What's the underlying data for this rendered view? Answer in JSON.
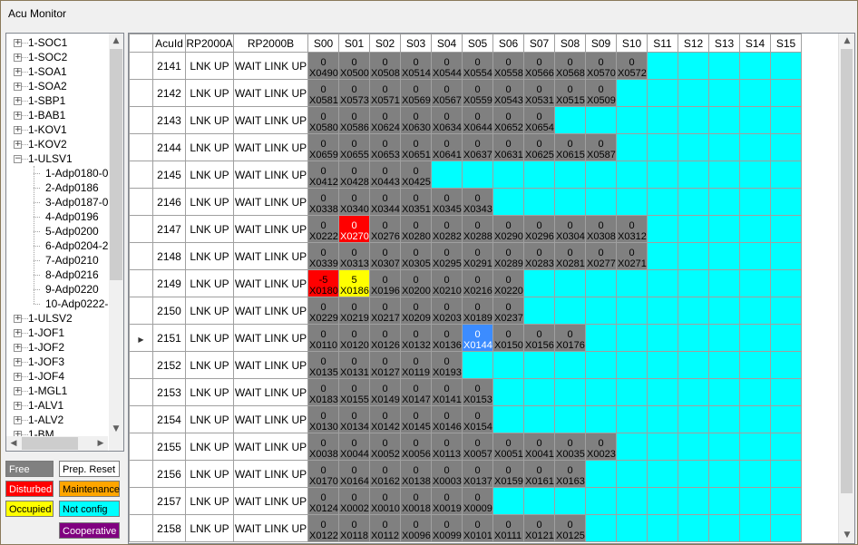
{
  "window": {
    "title": "Acu Monitor"
  },
  "tree": {
    "nodes": [
      {
        "label": "1-SOC1",
        "level": 0,
        "exp": "+"
      },
      {
        "label": "1-SOC2",
        "level": 0,
        "exp": "+"
      },
      {
        "label": "1-SOA1",
        "level": 0,
        "exp": "+"
      },
      {
        "label": "1-SOA2",
        "level": 0,
        "exp": "+"
      },
      {
        "label": "1-SBP1",
        "level": 0,
        "exp": "+"
      },
      {
        "label": "1-BAB1",
        "level": 0,
        "exp": "+"
      },
      {
        "label": "1-KOV1",
        "level": 0,
        "exp": "+"
      },
      {
        "label": "1-KOV2",
        "level": 0,
        "exp": "+"
      },
      {
        "label": "1-ULSV1",
        "level": 0,
        "exp": "-"
      },
      {
        "label": "1-Adp0180-0",
        "level": 1,
        "exp": ""
      },
      {
        "label": "2-Adp0186",
        "level": 1,
        "exp": ""
      },
      {
        "label": "3-Adp0187-0",
        "level": 1,
        "exp": ""
      },
      {
        "label": "4-Adp0196",
        "level": 1,
        "exp": ""
      },
      {
        "label": "5-Adp0200",
        "level": 1,
        "exp": ""
      },
      {
        "label": "6-Adp0204-2",
        "level": 1,
        "exp": ""
      },
      {
        "label": "7-Adp0210",
        "level": 1,
        "exp": ""
      },
      {
        "label": "8-Adp0216",
        "level": 1,
        "exp": ""
      },
      {
        "label": "9-Adp0220",
        "level": 1,
        "exp": ""
      },
      {
        "label": "10-Adp0222-2",
        "level": 1,
        "exp": ""
      },
      {
        "label": "1-ULSV2",
        "level": 0,
        "exp": "+"
      },
      {
        "label": "1-JOF1",
        "level": 0,
        "exp": "+"
      },
      {
        "label": "1-JOF2",
        "level": 0,
        "exp": "+"
      },
      {
        "label": "1-JOF3",
        "level": 0,
        "exp": "+"
      },
      {
        "label": "1-JOF4",
        "level": 0,
        "exp": "+"
      },
      {
        "label": "1-MGL1",
        "level": 0,
        "exp": "+"
      },
      {
        "label": "1-ALV1",
        "level": 0,
        "exp": "+"
      },
      {
        "label": "1-ALV2",
        "level": 0,
        "exp": "+"
      },
      {
        "label": "1-BM",
        "level": 0,
        "exp": "+"
      }
    ]
  },
  "legend": {
    "free": "Free",
    "prep_reset": "Prep. Reset",
    "disturbed": "Disturbed",
    "maintenance": "Maintenance",
    "occupied": "Occupied",
    "not_config": "Not config",
    "cooperative": "Cooperative"
  },
  "colors": {
    "free": "#808080",
    "disturbed": "#ff0000",
    "maintenance": "#ffa500",
    "occupied": "#ffff00",
    "not_config": "#00ffff",
    "cooperative": "#800080",
    "selected": "#3c8cff"
  },
  "grid": {
    "headers": [
      "AcuId",
      "RP2000A",
      "RP2000B",
      "S00",
      "S01",
      "S02",
      "S03",
      "S04",
      "S05",
      "S06",
      "S07",
      "S08",
      "S09",
      "S10",
      "S11",
      "S12",
      "S13",
      "S14",
      "S15"
    ],
    "current_row": 10,
    "rows": [
      {
        "acuid": "2141",
        "a": "LNK UP",
        "b": "WAIT LINK UP",
        "slots": [
          [
            "0",
            "X0490",
            "f"
          ],
          [
            "0",
            "X0500",
            "f"
          ],
          [
            "0",
            "X0508",
            "f"
          ],
          [
            "0",
            "X0514",
            "f"
          ],
          [
            "0",
            "X0544",
            "f"
          ],
          [
            "0",
            "X0554",
            "f"
          ],
          [
            "0",
            "X0558",
            "f"
          ],
          [
            "0",
            "X0566",
            "f"
          ],
          [
            "0",
            "X0568",
            "f"
          ],
          [
            "0",
            "X0570",
            "f"
          ],
          [
            "0",
            "X0572",
            "f"
          ]
        ]
      },
      {
        "acuid": "2142",
        "a": "LNK UP",
        "b": "WAIT LINK UP",
        "slots": [
          [
            "0",
            "X0581",
            "f"
          ],
          [
            "0",
            "X0573",
            "f"
          ],
          [
            "0",
            "X0571",
            "f"
          ],
          [
            "0",
            "X0569",
            "f"
          ],
          [
            "0",
            "X0567",
            "f"
          ],
          [
            "0",
            "X0559",
            "f"
          ],
          [
            "0",
            "X0543",
            "f"
          ],
          [
            "0",
            "X0531",
            "f"
          ],
          [
            "0",
            "X0515",
            "f"
          ],
          [
            "0",
            "X0509",
            "f"
          ]
        ]
      },
      {
        "acuid": "2143",
        "a": "LNK UP",
        "b": "WAIT LINK UP",
        "slots": [
          [
            "0",
            "X0580",
            "f"
          ],
          [
            "0",
            "X0586",
            "f"
          ],
          [
            "0",
            "X0624",
            "f"
          ],
          [
            "0",
            "X0630",
            "f"
          ],
          [
            "0",
            "X0634",
            "f"
          ],
          [
            "0",
            "X0644",
            "f"
          ],
          [
            "0",
            "X0652",
            "f"
          ],
          [
            "0",
            "X0654",
            "f"
          ]
        ]
      },
      {
        "acuid": "2144",
        "a": "LNK UP",
        "b": "WAIT LINK UP",
        "slots": [
          [
            "0",
            "X0659",
            "f"
          ],
          [
            "0",
            "X0655",
            "f"
          ],
          [
            "0",
            "X0653",
            "f"
          ],
          [
            "0",
            "X0651",
            "f"
          ],
          [
            "0",
            "X0641",
            "f"
          ],
          [
            "0",
            "X0637",
            "f"
          ],
          [
            "0",
            "X0631",
            "f"
          ],
          [
            "0",
            "X0625",
            "f"
          ],
          [
            "0",
            "X0615",
            "f"
          ],
          [
            "0",
            "X0587",
            "f"
          ]
        ]
      },
      {
        "acuid": "2145",
        "a": "LNK UP",
        "b": "WAIT LINK UP",
        "slots": [
          [
            "0",
            "X0412",
            "f"
          ],
          [
            "0",
            "X0428",
            "f"
          ],
          [
            "0",
            "X0443",
            "f"
          ],
          [
            "0",
            "X0425",
            "f"
          ]
        ]
      },
      {
        "acuid": "2146",
        "a": "LNK UP",
        "b": "WAIT LINK UP",
        "slots": [
          [
            "0",
            "X0338",
            "f"
          ],
          [
            "0",
            "X0340",
            "f"
          ],
          [
            "0",
            "X0344",
            "f"
          ],
          [
            "0",
            "X0351",
            "f"
          ],
          [
            "0",
            "X0345",
            "f"
          ],
          [
            "0",
            "X0343",
            "f"
          ]
        ]
      },
      {
        "acuid": "2147",
        "a": "LNK UP",
        "b": "WAIT LINK UP",
        "slots": [
          [
            "0",
            "X0222",
            "f"
          ],
          [
            "0",
            "X0270",
            "d"
          ],
          [
            "0",
            "X0276",
            "f"
          ],
          [
            "0",
            "X0280",
            "f"
          ],
          [
            "0",
            "X0282",
            "f"
          ],
          [
            "0",
            "X0288",
            "f"
          ],
          [
            "0",
            "X0290",
            "f"
          ],
          [
            "0",
            "X0296",
            "f"
          ],
          [
            "0",
            "X0304",
            "f"
          ],
          [
            "0",
            "X0308",
            "f"
          ],
          [
            "0",
            "X0312",
            "f"
          ]
        ]
      },
      {
        "acuid": "2148",
        "a": "LNK UP",
        "b": "WAIT LINK UP",
        "slots": [
          [
            "0",
            "X0339",
            "f"
          ],
          [
            "0",
            "X0313",
            "f"
          ],
          [
            "0",
            "X0307",
            "f"
          ],
          [
            "0",
            "X0305",
            "f"
          ],
          [
            "0",
            "X0295",
            "f"
          ],
          [
            "0",
            "X0291",
            "f"
          ],
          [
            "0",
            "X0289",
            "f"
          ],
          [
            "0",
            "X0283",
            "f"
          ],
          [
            "0",
            "X0281",
            "f"
          ],
          [
            "0",
            "X0277",
            "f"
          ],
          [
            "0",
            "X0271",
            "f"
          ]
        ]
      },
      {
        "acuid": "2149",
        "a": "LNK UP",
        "b": "WAIT LINK UP",
        "slots": [
          [
            "-5",
            "X0180",
            "d"
          ],
          [
            "5",
            "X0186",
            "o"
          ],
          [
            "0",
            "X0196",
            "f"
          ],
          [
            "0",
            "X0200",
            "f"
          ],
          [
            "0",
            "X0210",
            "f"
          ],
          [
            "0",
            "X0216",
            "f"
          ],
          [
            "0",
            "X0220",
            "f"
          ]
        ]
      },
      {
        "acuid": "2150",
        "a": "LNK UP",
        "b": "WAIT LINK UP",
        "slots": [
          [
            "0",
            "X0229",
            "f"
          ],
          [
            "0",
            "X0219",
            "f"
          ],
          [
            "0",
            "X0217",
            "f"
          ],
          [
            "0",
            "X0209",
            "f"
          ],
          [
            "0",
            "X0203",
            "f"
          ],
          [
            "0",
            "X0189",
            "f"
          ],
          [
            "0",
            "X0237",
            "f"
          ]
        ]
      },
      {
        "acuid": "2151",
        "a": "LNK UP",
        "b": "WAIT LINK UP",
        "slots": [
          [
            "0",
            "X0110",
            "f"
          ],
          [
            "0",
            "X0120",
            "f"
          ],
          [
            "0",
            "X0126",
            "f"
          ],
          [
            "0",
            "X0132",
            "f"
          ],
          [
            "0",
            "X0136",
            "f"
          ],
          [
            "0",
            "X0144",
            "s"
          ],
          [
            "0",
            "X0150",
            "f"
          ],
          [
            "0",
            "X0156",
            "f"
          ],
          [
            "0",
            "X0176",
            "f"
          ]
        ]
      },
      {
        "acuid": "2152",
        "a": "LNK UP",
        "b": "WAIT LINK UP",
        "slots": [
          [
            "0",
            "X0135",
            "f"
          ],
          [
            "0",
            "X0131",
            "f"
          ],
          [
            "0",
            "X0127",
            "f"
          ],
          [
            "0",
            "X0119",
            "f"
          ],
          [
            "0",
            "X0193",
            "f"
          ]
        ]
      },
      {
        "acuid": "2153",
        "a": "LNK UP",
        "b": "WAIT LINK UP",
        "slots": [
          [
            "0",
            "X0183",
            "f"
          ],
          [
            "0",
            "X0155",
            "f"
          ],
          [
            "0",
            "X0149",
            "f"
          ],
          [
            "0",
            "X0147",
            "f"
          ],
          [
            "0",
            "X0141",
            "f"
          ],
          [
            "0",
            "X0153",
            "f"
          ]
        ]
      },
      {
        "acuid": "2154",
        "a": "LNK UP",
        "b": "WAIT LINK UP",
        "slots": [
          [
            "0",
            "X0130",
            "f"
          ],
          [
            "0",
            "X0134",
            "f"
          ],
          [
            "0",
            "X0142",
            "f"
          ],
          [
            "0",
            "X0145",
            "f"
          ],
          [
            "0",
            "X0146",
            "f"
          ],
          [
            "0",
            "X0154",
            "f"
          ]
        ]
      },
      {
        "acuid": "2155",
        "a": "LNK UP",
        "b": "WAIT LINK UP",
        "slots": [
          [
            "0",
            "X0038",
            "f"
          ],
          [
            "0",
            "X0044",
            "f"
          ],
          [
            "0",
            "X0052",
            "f"
          ],
          [
            "0",
            "X0056",
            "f"
          ],
          [
            "0",
            "X0113",
            "f"
          ],
          [
            "0",
            "X0057",
            "f"
          ],
          [
            "0",
            "X0051",
            "f"
          ],
          [
            "0",
            "X0041",
            "f"
          ],
          [
            "0",
            "X0035",
            "f"
          ],
          [
            "0",
            "X0023",
            "f"
          ]
        ]
      },
      {
        "acuid": "2156",
        "a": "LNK UP",
        "b": "WAIT LINK UP",
        "slots": [
          [
            "0",
            "X0170",
            "f"
          ],
          [
            "0",
            "X0164",
            "f"
          ],
          [
            "0",
            "X0162",
            "f"
          ],
          [
            "0",
            "X0138",
            "f"
          ],
          [
            "0",
            "X0003",
            "f"
          ],
          [
            "0",
            "X0137",
            "f"
          ],
          [
            "0",
            "X0159",
            "f"
          ],
          [
            "0",
            "X0161",
            "f"
          ],
          [
            "0",
            "X0163",
            "f"
          ]
        ]
      },
      {
        "acuid": "2157",
        "a": "LNK UP",
        "b": "WAIT LINK UP",
        "slots": [
          [
            "0",
            "X0124",
            "f"
          ],
          [
            "0",
            "X0002",
            "f"
          ],
          [
            "0",
            "X0010",
            "f"
          ],
          [
            "0",
            "X0018",
            "f"
          ],
          [
            "0",
            "X0019",
            "f"
          ],
          [
            "0",
            "X0009",
            "f"
          ]
        ]
      },
      {
        "acuid": "2158",
        "a": "LNK UP",
        "b": "WAIT LINK UP",
        "slots": [
          [
            "0",
            "X0122",
            "f"
          ],
          [
            "0",
            "X0118",
            "f"
          ],
          [
            "0",
            "X0112",
            "f"
          ],
          [
            "0",
            "X0096",
            "f"
          ],
          [
            "0",
            "X0099",
            "f"
          ],
          [
            "0",
            "X0101",
            "f"
          ],
          [
            "0",
            "X0111",
            "f"
          ],
          [
            "0",
            "X0121",
            "f"
          ],
          [
            "0",
            "X0125",
            "f"
          ]
        ]
      }
    ]
  }
}
